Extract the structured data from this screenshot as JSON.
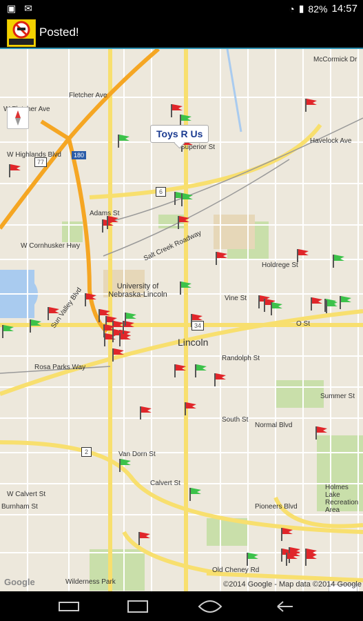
{
  "status": {
    "battery": "82%",
    "time": "14:57"
  },
  "app": {
    "title": "Posted!",
    "logo_text": "Criminal Protection Zone"
  },
  "callout": {
    "text": "Toys R Us"
  },
  "map": {
    "city_label": "Lincoln",
    "university": "University of Nebraska-Lincoln",
    "park": "Holmes Lake Recreation Area",
    "park2": "Wilderness Park",
    "streets": [
      "W Fletcher Ave",
      "Fletcher Ave",
      "W Highlands Blvd",
      "Superior St",
      "W Cornhusker Hwy",
      "Adams St",
      "Holdrege St",
      "Vine St",
      "O St",
      "Randolph St",
      "Rosa Parks Way",
      "Summer St",
      "South St",
      "Normal Blvd",
      "Van Dorn St",
      "Calvert St",
      "W Calvert St",
      "Pioneers Blvd",
      "Old Cheney Rd",
      "Havelock Ave",
      "McCormick Dr",
      "Burnham St",
      "Salt Creek Roadway",
      "Sun Valley Blvd"
    ],
    "route_shields": [
      "180",
      "77",
      "6",
      "34",
      "2"
    ],
    "attribution": "©2014 Google - Map data ©2014 Google",
    "google": "Google",
    "zoom_in": "+",
    "zoom_out": "−"
  },
  "flags_red": 38,
  "flags_green": 18,
  "colors": {
    "flag_red": "#e0262a",
    "flag_green": "#3cc24a",
    "highway": "#f5a623",
    "accent": "#2a8fb0"
  }
}
